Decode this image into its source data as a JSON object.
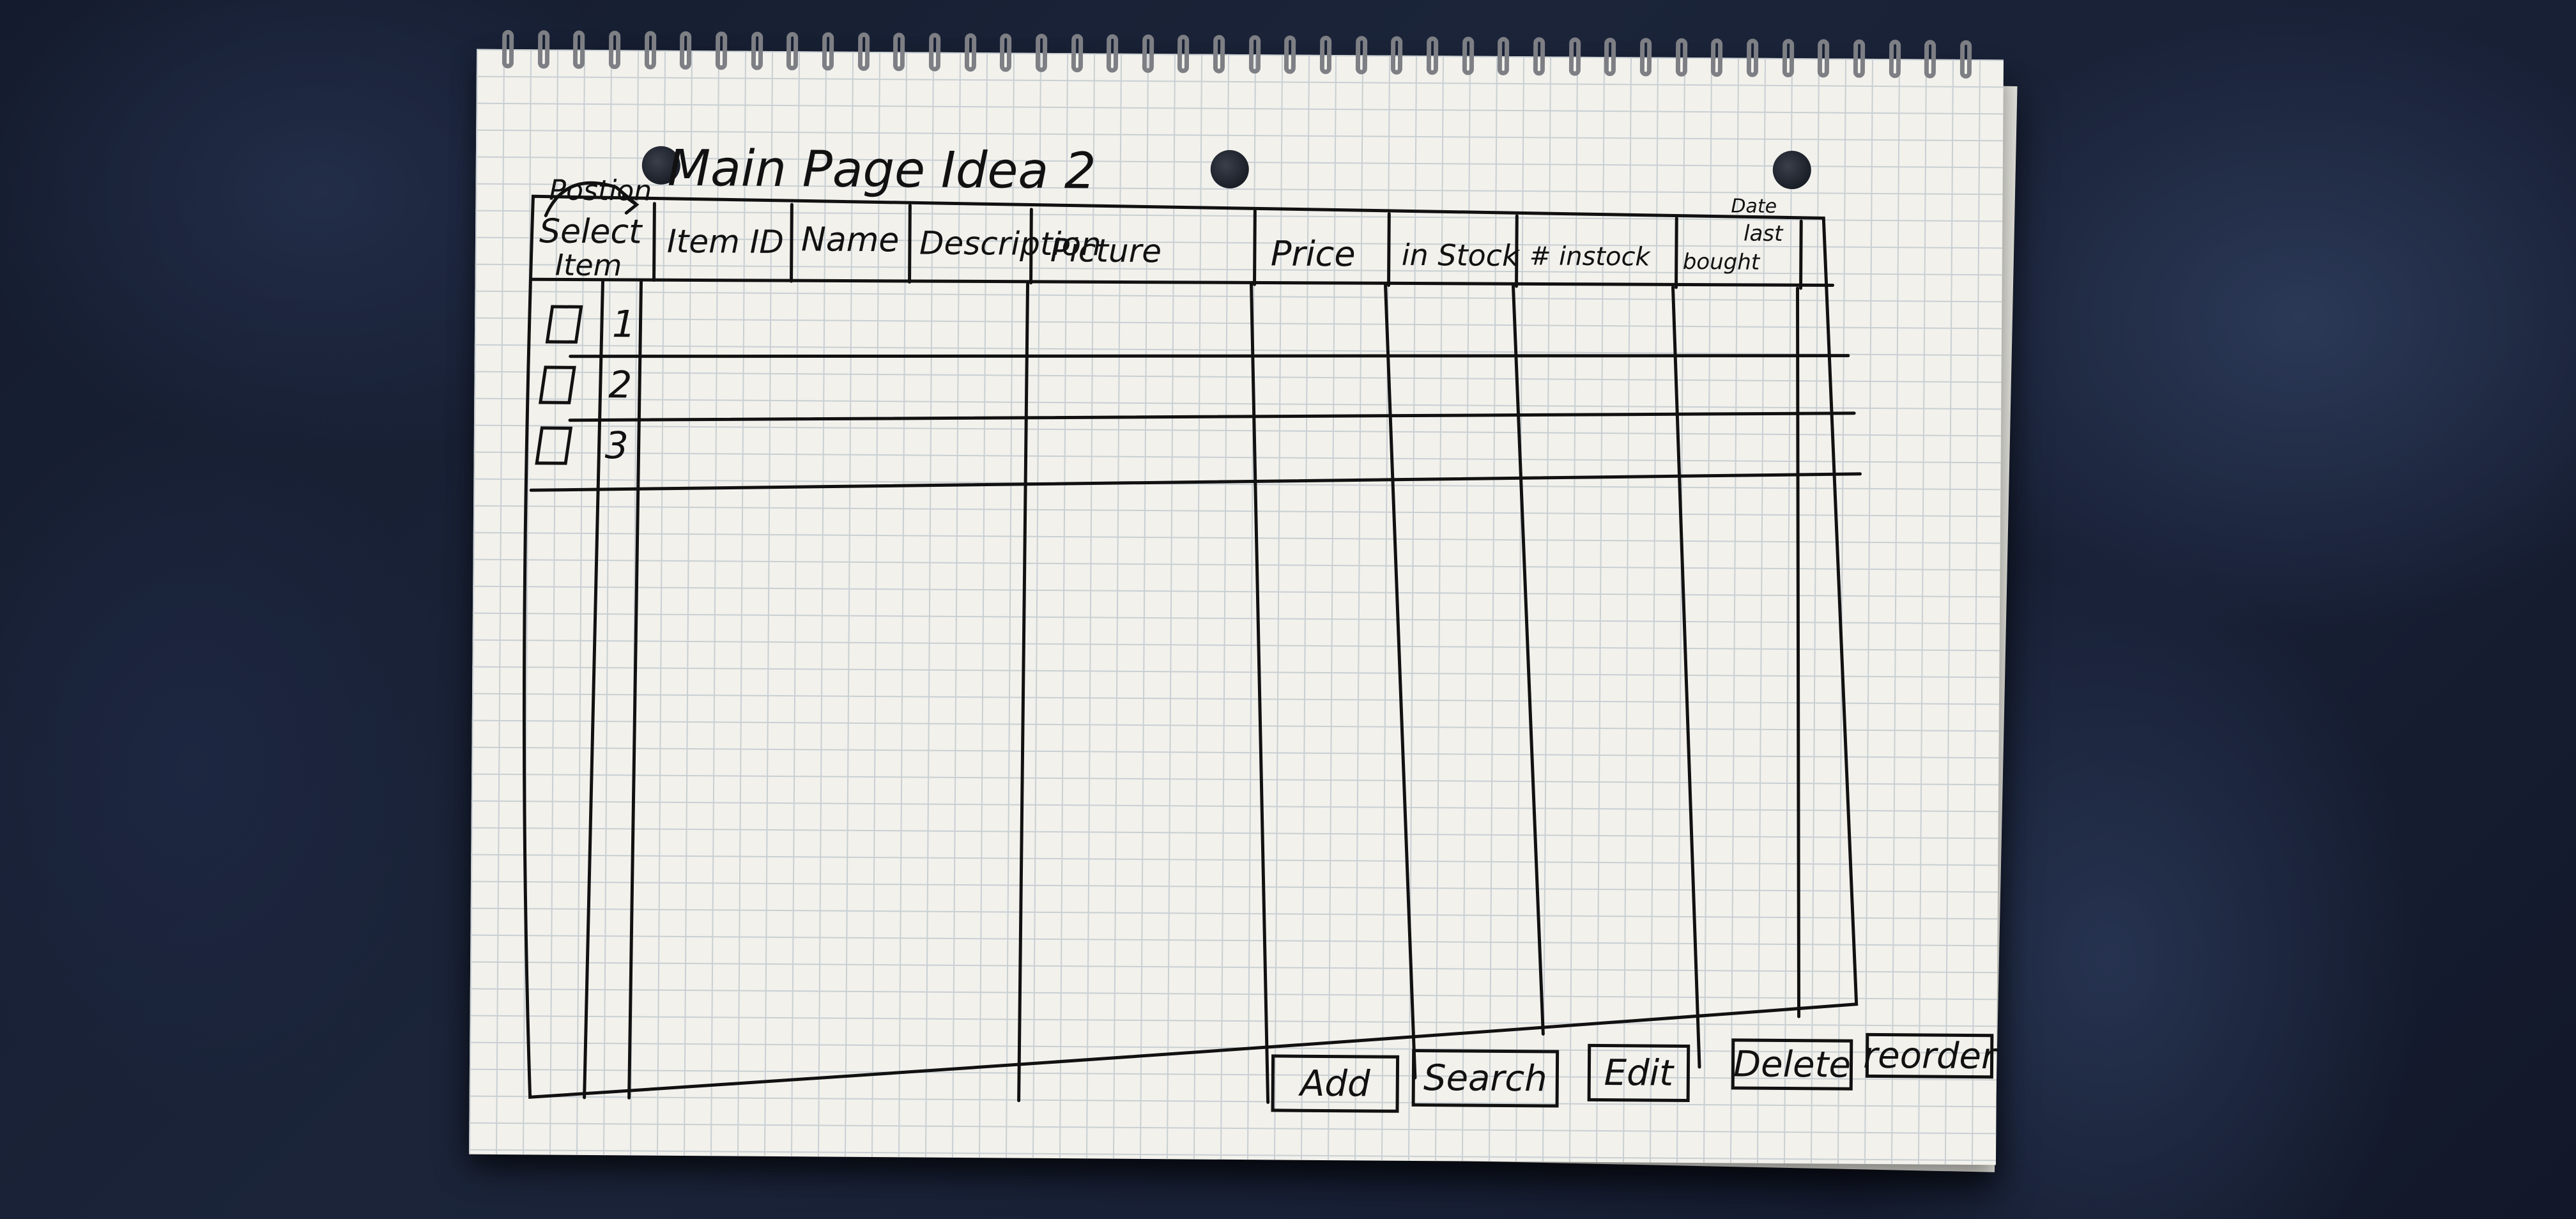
{
  "title": "Main Page Idea 2",
  "position_note": "Postion",
  "columns": [
    "Select Item",
    "Item ID",
    "Name",
    "Description",
    "Picture",
    "Price",
    "in Stock",
    "# instock",
    "Date last bought"
  ],
  "header_parts": {
    "select_top": "Select",
    "select_bottom": "Item",
    "date_top": "Date",
    "date_mid": "last",
    "date_bottom": "bought"
  },
  "rows": [
    {
      "position": "1",
      "checked": false
    },
    {
      "position": "2",
      "checked": false
    },
    {
      "position": "3",
      "checked": false
    }
  ],
  "buttons": {
    "add": "Add",
    "search": "Search",
    "edit": "Edit",
    "delete": "Delete",
    "reorder": "reorder"
  },
  "colors": {
    "ink": "#111111",
    "paper": "#f2f1ec",
    "grid": "#c9cfd3",
    "fabric": "#1b2439"
  }
}
